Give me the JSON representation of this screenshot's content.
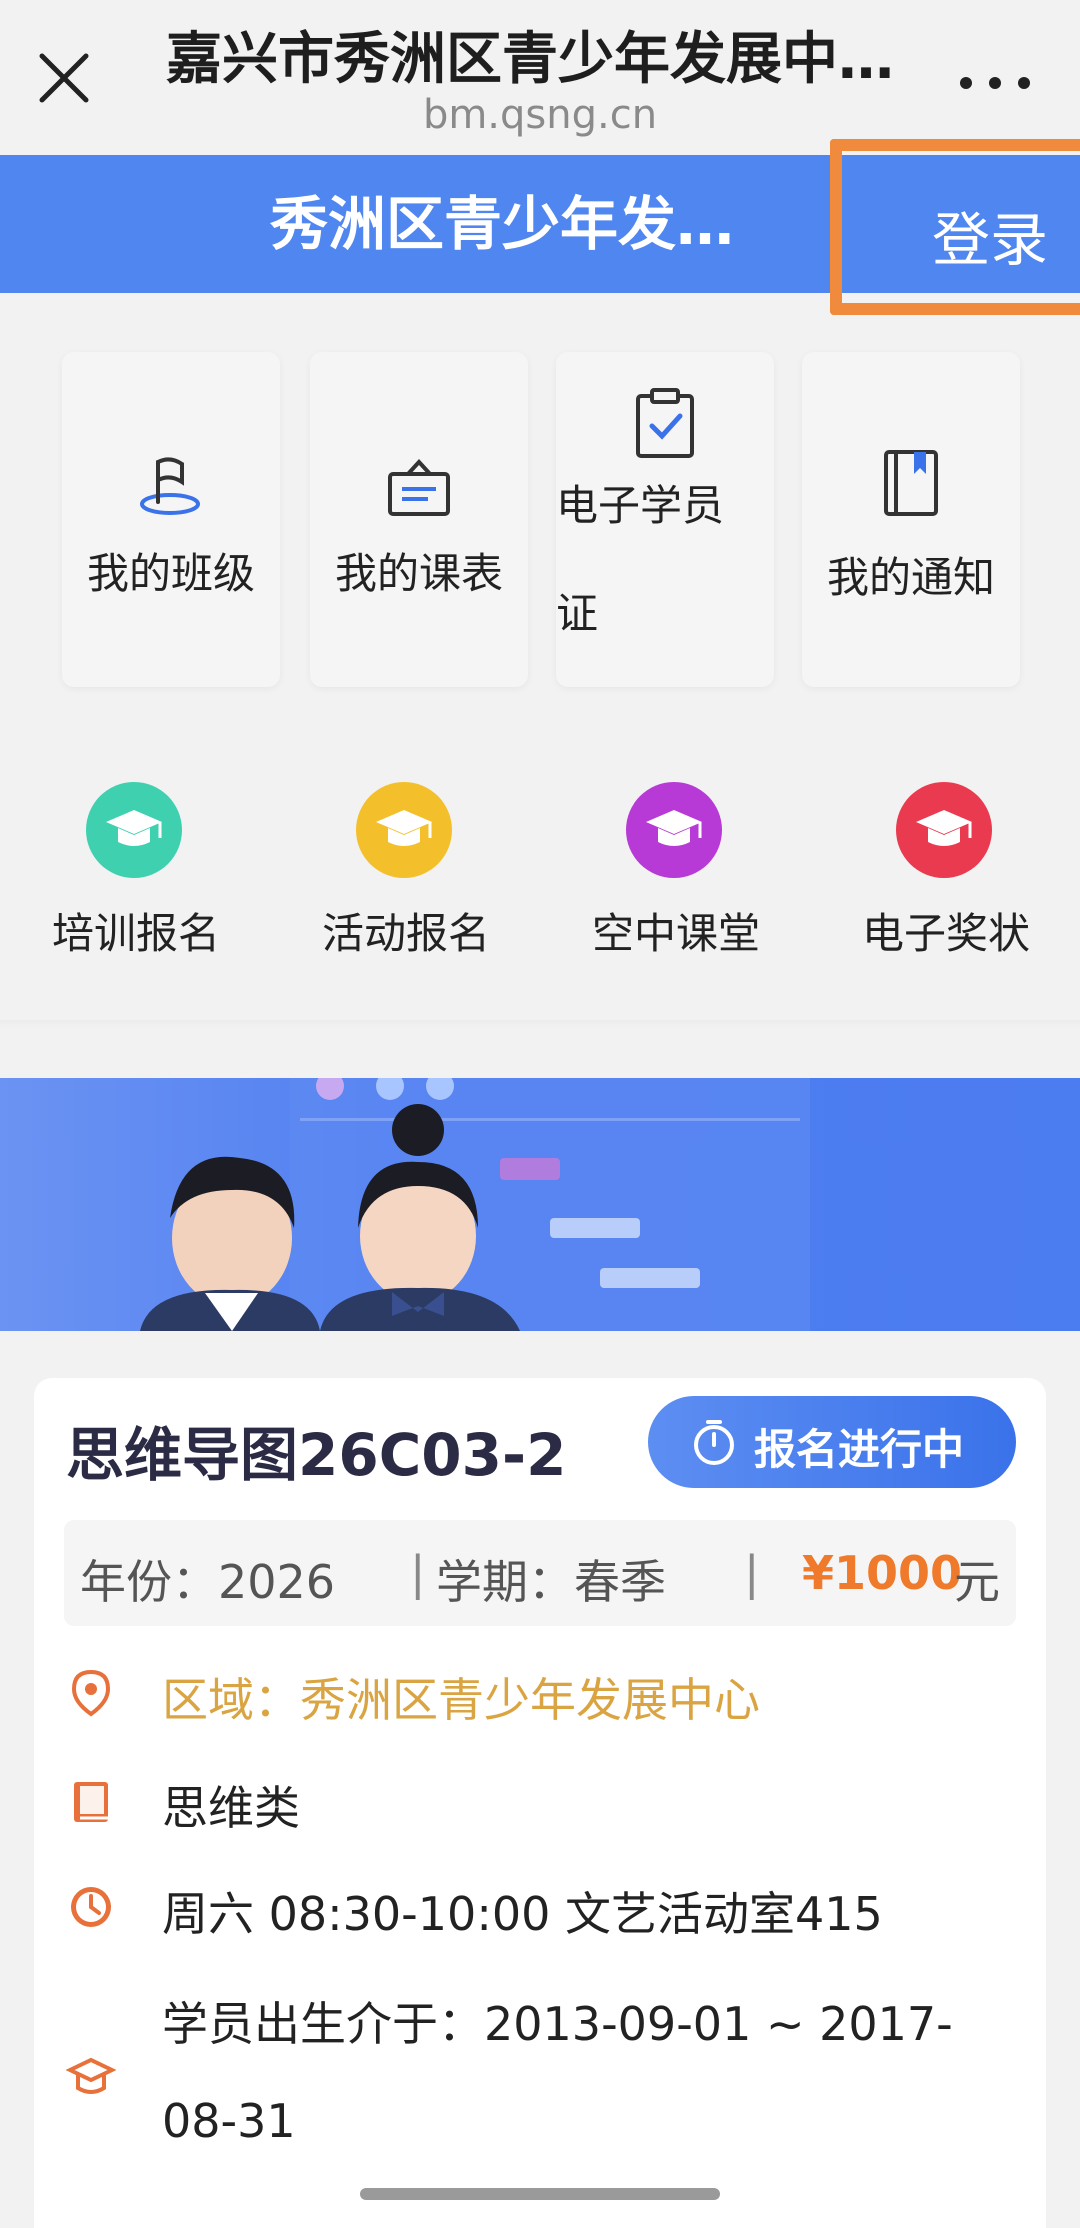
{
  "browser": {
    "title": "嘉兴市秀洲区青少年发展中…",
    "url": "bm.qsng.cn"
  },
  "header": {
    "title": "秀洲区青少年发…",
    "login_label": "登录"
  },
  "quick_links": [
    {
      "label": "我的班级",
      "icon": "flag-icon"
    },
    {
      "label": "我的课表",
      "icon": "schedule-icon"
    },
    {
      "label": "电子学员证",
      "line1": "电子学员",
      "line2": "证",
      "icon": "clipboard-check-icon"
    },
    {
      "label": "我的通知",
      "icon": "notebook-icon"
    }
  ],
  "categories": [
    {
      "label": "培训报名",
      "icon": "graduation-cap-icon",
      "color": "#3fd0b0"
    },
    {
      "label": "活动报名",
      "icon": "graduation-cap-icon",
      "color": "#f3c02c"
    },
    {
      "label": "空中课堂",
      "icon": "graduation-cap-icon",
      "color": "#b83ad6"
    },
    {
      "label": "电子奖状",
      "icon": "graduation-cap-icon",
      "color": "#ea3a4f"
    }
  ],
  "course": {
    "name": "思维导图26C03-2",
    "status": "报名进行中",
    "year_label": "年份：2026",
    "sep1": "|",
    "term_label": "学期：春季",
    "sep2": "|",
    "price": "¥1000",
    "price_unit": "元",
    "region": "区域：秀洲区青少年发展中心",
    "category": "思维类",
    "schedule": "周六 08:30-10:00 文艺活动室415",
    "birth_line1": "学员出生介于：2013-09-01 ~ 2017-",
    "birth_line2": "08-31"
  },
  "colors": {
    "brand_blue": "#4f86f0",
    "highlight_orange": "#f08b3e",
    "price_orange": "#f07a2c",
    "region_gold": "#d9a441",
    "icon_orange": "#e8703a"
  }
}
